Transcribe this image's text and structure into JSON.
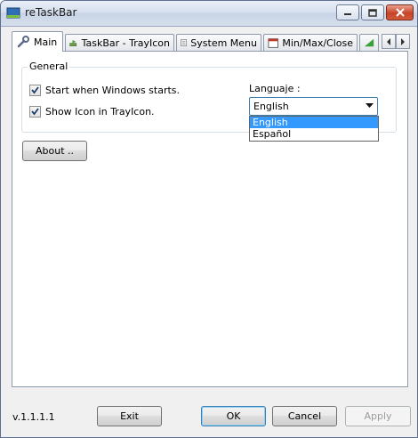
{
  "window": {
    "title": "reTaskBar"
  },
  "tabs": [
    {
      "label": "Main",
      "icon": "wrench-icon"
    },
    {
      "label": "TaskBar - TrayIcon",
      "icon": "taskbar-arrow-icon"
    },
    {
      "label": "System Menu",
      "icon": "document-list-icon"
    },
    {
      "label": "Min/Max/Close",
      "icon": "window-controls-icon"
    },
    {
      "label": "",
      "icon": "signal-bars-icon"
    }
  ],
  "general": {
    "group_label": "General",
    "start_with_windows": {
      "label": "Start when Windows starts.",
      "checked": true
    },
    "show_tray_icon": {
      "label": "Show Icon in TrayIcon.",
      "checked": true
    },
    "language_label": "Languaje :",
    "language_selected": "English",
    "language_options": [
      "English",
      "Español"
    ]
  },
  "about_button": "About ..",
  "footer": {
    "version": "v.1.1.1.1",
    "exit": "Exit",
    "ok": "OK",
    "cancel": "Cancel",
    "apply": "Apply"
  },
  "colors": {
    "selection": "#3399ff",
    "focus_border": "#3c7fb1"
  }
}
